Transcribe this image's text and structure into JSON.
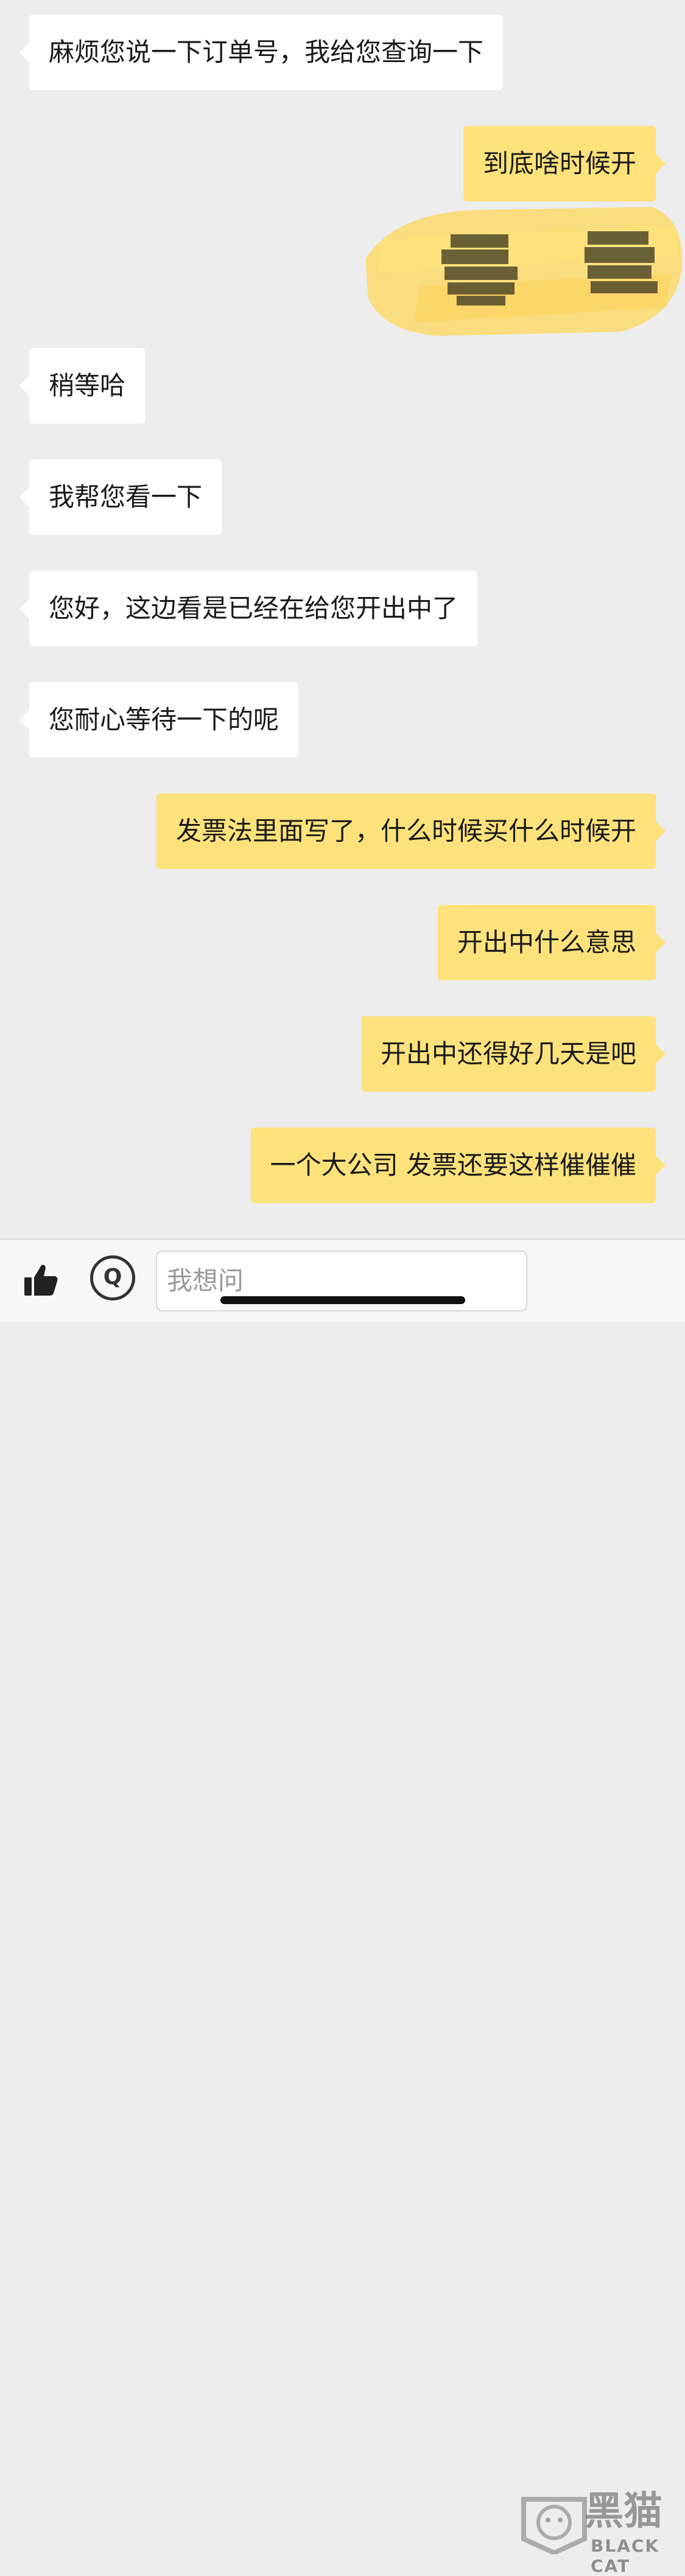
{
  "messages": [
    {
      "side": "left",
      "text": "麻烦您说一下订单号，我给您查询一下"
    },
    {
      "side": "right",
      "text": "到底啥时候开"
    },
    {
      "side": "left",
      "text": "稍等哈"
    },
    {
      "side": "left",
      "text": "我帮您看一下"
    },
    {
      "side": "left",
      "text": "您好，这边看是已经在给您开出中了"
    },
    {
      "side": "left",
      "text": "您耐心等待一下的呢"
    },
    {
      "side": "right",
      "text": "发票法里面写了，什么时候买什么时候开"
    },
    {
      "side": "right",
      "text": "开出中什么意思"
    },
    {
      "side": "right",
      "text": "开出中还得好几天是吧"
    },
    {
      "side": "right",
      "text": "一个大公司 发票还要这样催催催"
    }
  ],
  "input": {
    "placeholder": "我想问"
  },
  "toolbar": {
    "ask_label": "Q",
    "like_icon": "thumbs-up-icon"
  },
  "watermark": {
    "title": "黑猫",
    "subtitle": "BLACK CAT"
  },
  "colors": {
    "background": "#ededed",
    "incoming_bubble": "#ffffff",
    "outgoing_bubble": "#fde27b",
    "redaction": "#fcd96a"
  }
}
